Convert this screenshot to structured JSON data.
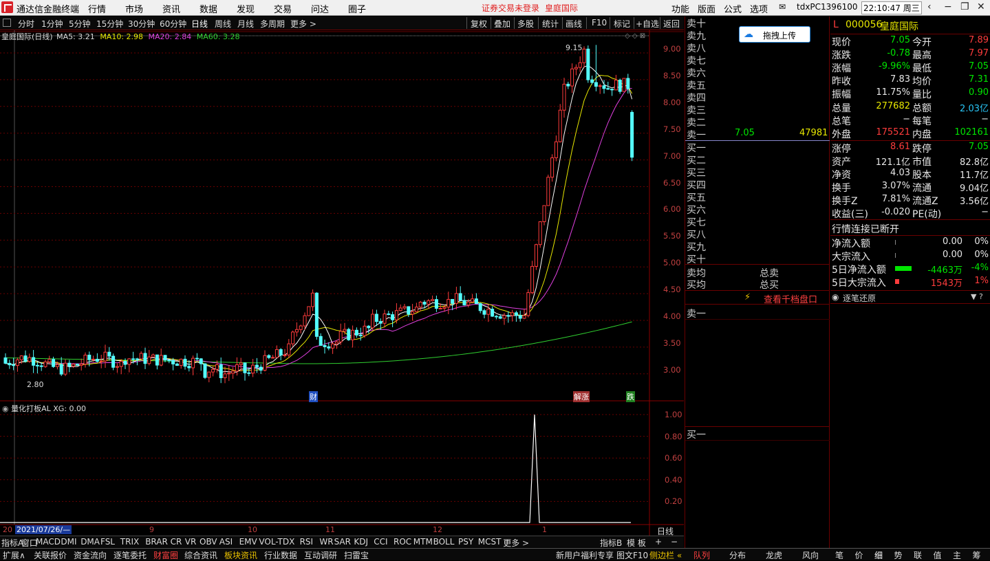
{
  "menubar": {
    "app_title": "通达信金融终端",
    "menus": [
      "行情",
      "市场",
      "资讯",
      "数据",
      "发现",
      "交易",
      "问达",
      "圈子"
    ],
    "notice": "证券交易未登录",
    "notice_stock": "皇庭国际",
    "right_menus": [
      "功能",
      "版面",
      "公式",
      "选项"
    ],
    "user": "tdxPC1396100",
    "clock": "22:10:47 周三"
  },
  "toolbar": {
    "periods": [
      "分时",
      "1分钟",
      "5分钟",
      "15分钟",
      "30分钟",
      "60分钟",
      "日线",
      "周线",
      "月线",
      "多周期",
      "更多 >"
    ],
    "actions": [
      "复权",
      "叠加",
      "多股",
      "统计",
      "画线",
      "F10",
      "标记",
      "+自选",
      "返回"
    ]
  },
  "kline": {
    "title": "皇庭国际(日线)",
    "ma5": "MA5: 3.21",
    "ma10": "MA10: 2.98",
    "ma20": "MA20: 2.84",
    "ma60": "MA60: 3.28",
    "high_marker": "9.15",
    "low_marker": "2.80",
    "events": [
      "财",
      "解涨",
      "跌"
    ],
    "y_ticks": [
      "9.00",
      "8.50",
      "8.00",
      "7.50",
      "7.00",
      "6.50",
      "6.00",
      "5.50",
      "5.00",
      "4.50",
      "4.00",
      "3.50",
      "3.00"
    ]
  },
  "indicator": {
    "title": "量化打板AL XG: 0.00",
    "y_ticks": [
      "1.00",
      "0.80",
      "0.60",
      "0.40",
      "0.20"
    ]
  },
  "xaxis": {
    "start": "20",
    "cursor_date": "2021/07/26/—",
    "months": [
      "9",
      "10",
      "11",
      "12",
      "1"
    ],
    "period_label": "日线"
  },
  "bottom_tabs": [
    "指标A",
    "窗口",
    "MACD",
    "DMI",
    "DMA",
    "FSL",
    "TRIX",
    "BRAR",
    "CR",
    "VR",
    "OBV",
    "ASI",
    "EMV",
    "VOL-TDX",
    "RSI",
    "WR",
    "SAR",
    "KDJ",
    "CCI",
    "ROC",
    "MTM",
    "BOLL",
    "PSY",
    "MCST",
    "更多 >",
    "指标B",
    "模 板",
    "+",
    "−"
  ],
  "status_bar": {
    "left": [
      "扩展∧",
      "关联报价",
      "资金流向",
      "逐笔委托",
      "财富圈",
      "综合资讯",
      "板块资讯",
      "行业数据",
      "互动调研",
      "扫雷宝"
    ],
    "promo": "新用户福利专享",
    "f10": "图文F10",
    "sidebar": "侧边栏 «",
    "right_tabs": [
      "队列",
      "分布",
      "龙虎",
      "风向"
    ],
    "far_right": [
      "笔",
      "价",
      "细",
      "势",
      "联",
      "值",
      "主",
      "筹"
    ]
  },
  "orderbook": {
    "upload_button": "拖拽上传",
    "sells": [
      "卖十",
      "卖九",
      "卖八",
      "卖七",
      "卖六",
      "卖五",
      "卖四",
      "卖三",
      "卖二",
      "卖一"
    ],
    "sell1_price": "7.05",
    "sell1_vol": "47981",
    "buys": [
      "买一",
      "买二",
      "买三",
      "买四",
      "买五",
      "买六",
      "买七",
      "买八",
      "买九",
      "买十"
    ],
    "sell_avg": "卖均",
    "buy_avg": "买均",
    "total_sell": "总卖",
    "total_buy": "总买",
    "depth_link": "查看千档盘口",
    "queue_sell": "卖一",
    "queue_buy": "买一"
  },
  "quote": {
    "market": "L",
    "code": "000056",
    "name": "皇庭国际",
    "rows": [
      {
        "l1": "现价",
        "v1": "7.05",
        "c1": "green",
        "l2": "今开",
        "v2": "7.89",
        "c2": "red"
      },
      {
        "l1": "涨跌",
        "v1": "-0.78",
        "c1": "green",
        "l2": "最高",
        "v2": "7.97",
        "c2": "red"
      },
      {
        "l1": "涨幅",
        "v1": "-9.96%",
        "c1": "green",
        "l2": "最低",
        "v2": "7.05",
        "c2": "green"
      },
      {
        "l1": "昨收",
        "v1": "7.83",
        "c1": "white",
        "l2": "均价",
        "v2": "7.31",
        "c2": "green"
      },
      {
        "l1": "振幅",
        "v1": "11.75%",
        "c1": "white",
        "l2": "量比",
        "v2": "0.90",
        "c2": "green"
      },
      {
        "l1": "总量",
        "v1": "277682",
        "c1": "yellow",
        "l2": "总额",
        "v2": "2.03亿",
        "c2": "cyan"
      },
      {
        "l1": "总笔",
        "v1": "−",
        "c1": "white",
        "l2": "每笔",
        "v2": "−",
        "c2": "white"
      },
      {
        "l1": "外盘",
        "v1": "175521",
        "c1": "red",
        "l2": "内盘",
        "v2": "102161",
        "c2": "green"
      },
      {
        "l1": "涨停",
        "v1": "8.61",
        "c1": "red",
        "l2": "跌停",
        "v2": "7.05",
        "c2": "green"
      },
      {
        "l1": "资产",
        "v1": "121.1亿",
        "c1": "white",
        "l2": "市值",
        "v2": "82.8亿",
        "c2": "white"
      },
      {
        "l1": "净资",
        "v1": "4.03",
        "c1": "white",
        "l2": "股本",
        "v2": "11.7亿",
        "c2": "white"
      },
      {
        "l1": "换手",
        "v1": "3.07%",
        "c1": "white",
        "l2": "流通",
        "v2": "9.04亿",
        "c2": "white"
      },
      {
        "l1": "换手Z",
        "v1": "7.81%",
        "c1": "white",
        "l2": "流通Z",
        "v2": "3.56亿",
        "c2": "white"
      },
      {
        "l1": "收益(三)",
        "v1": "-0.020",
        "c1": "white",
        "l2": "PE(动)",
        "v2": "−",
        "c2": "white"
      }
    ],
    "conn_status": "行情连接已断开",
    "flows": [
      {
        "label": "净流入额",
        "value": "0.00",
        "pct": "0%",
        "color": "white"
      },
      {
        "label": "大宗流入",
        "value": "0.00",
        "pct": "0%",
        "color": "white"
      },
      {
        "label": "5日净流入额",
        "value": "-4463万",
        "pct": "-4%",
        "color": "green"
      },
      {
        "label": "5日大宗流入",
        "value": "1543万",
        "pct": "1%",
        "color": "red"
      }
    ],
    "tick_restore": "逐笔还原"
  }
}
